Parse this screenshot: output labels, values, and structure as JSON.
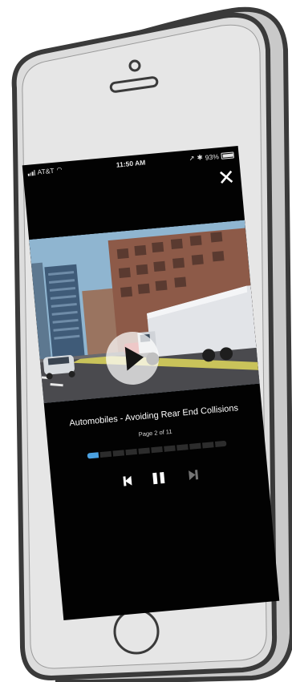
{
  "status_bar": {
    "carrier": "AT&T",
    "time": "11:50 AM",
    "battery": "93%"
  },
  "lesson": {
    "title": "Automobiles - Avoiding Rear End Collisions",
    "page_indicator": "Page 2 of 11",
    "current_page": 2,
    "total_pages": 11
  },
  "icons": {
    "close": "close-icon",
    "play": "play-icon",
    "previous": "skip-previous-icon",
    "pause": "pause-icon",
    "next": "skip-next-icon",
    "home_button": "home-button",
    "speaker": "earpiece-speaker",
    "camera": "front-camera"
  },
  "colors": {
    "screen_background": "#020202",
    "progress_active": "#4aa0e0",
    "progress_inactive": "#2c2c2c",
    "phone_body": "#d9d9d9",
    "phone_outline": "#3a3a3a"
  }
}
